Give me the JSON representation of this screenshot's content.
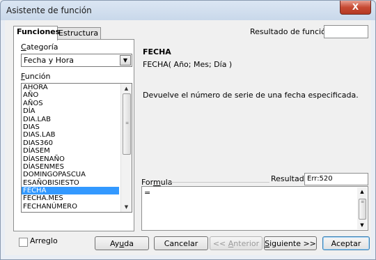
{
  "window": {
    "title": "Asistente de función",
    "close": "X"
  },
  "tabs": [
    {
      "label": "Funciones"
    },
    {
      "label": "Estructura"
    }
  ],
  "category": {
    "label_first": "C",
    "label_rest": "ategoría",
    "value": "Fecha y Hora",
    "dropdown_icon": "▼"
  },
  "function": {
    "label_first": "F",
    "label_rest": "unción",
    "items": [
      "AHORA",
      "AÑO",
      "AÑOS",
      "DÍA",
      "DIA.LAB",
      "DIAS",
      "DIAS.LAB",
      "DIAS360",
      "DÍASEM",
      "DÍASENAÑO",
      "DÍASENMES",
      "DOMINGOPASCUA",
      "ESAÑOBISIESTO",
      "FECHA",
      "FECHA.MES",
      "FECHANÚMERO"
    ],
    "selected": "FECHA"
  },
  "result_label": "Resultado de función",
  "detail": {
    "name": "FECHA",
    "syntax": "FECHA( Año; Mes; Día )",
    "description": "Devuelve el número de serie de una fecha especificada."
  },
  "formula": {
    "label_pre": "For",
    "label_u": "m",
    "label_post": "ula",
    "value": "="
  },
  "result": {
    "label": "Resultado",
    "value": "Err:520"
  },
  "array": {
    "label": "Arreglo"
  },
  "buttons": {
    "help_pre": "Ay",
    "help_u": "u",
    "help_post": "da",
    "cancel": "Cancelar",
    "back_pre": "<< ",
    "back_u": "A",
    "back_post": "nterior",
    "next_u": "S",
    "next_post": "iguiente >>",
    "accept": "Aceptar"
  }
}
